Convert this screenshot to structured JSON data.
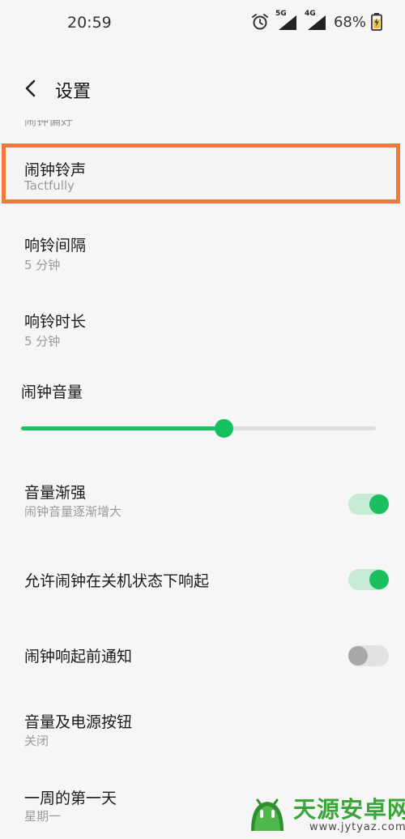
{
  "status_bar": {
    "time": "20:59",
    "net_tag_1": "5G",
    "net_tag_2": "4G",
    "battery": "68%",
    "icons": [
      "alarm-icon",
      "signal-5g-icon",
      "signal-4g-icon",
      "battery-charging-icon"
    ]
  },
  "header": {
    "title": "设置",
    "back_icon": "chevron-left-icon"
  },
  "previous_item_partial": "闹钟偏好",
  "items": [
    {
      "title": "闹钟铃声",
      "subtitle": "Tactfully",
      "highlighted": true
    },
    {
      "title": "响铃间隔",
      "subtitle": "5 分钟"
    },
    {
      "title": "响铃时长",
      "subtitle": "5 分钟"
    }
  ],
  "volume": {
    "label": "闹钟音量",
    "level": 0.57
  },
  "toggles": [
    {
      "title": "音量渐强",
      "subtitle": "闹钟音量逐渐增大",
      "on": true
    },
    {
      "title": "允许闹钟在关机状态下响起",
      "on": true
    },
    {
      "title": "闹钟响起前通知",
      "on": false
    }
  ],
  "more_items": [
    {
      "title": "音量及电源按钮",
      "subtitle": "关闭"
    },
    {
      "title": "一周的第一天",
      "subtitle": "星期一"
    }
  ],
  "watermark": {
    "name": "天源安卓网",
    "url": "www.jytyaz.com"
  },
  "colors": {
    "accent": "#1bbf5f",
    "highlight_border": "#f07a3e"
  }
}
